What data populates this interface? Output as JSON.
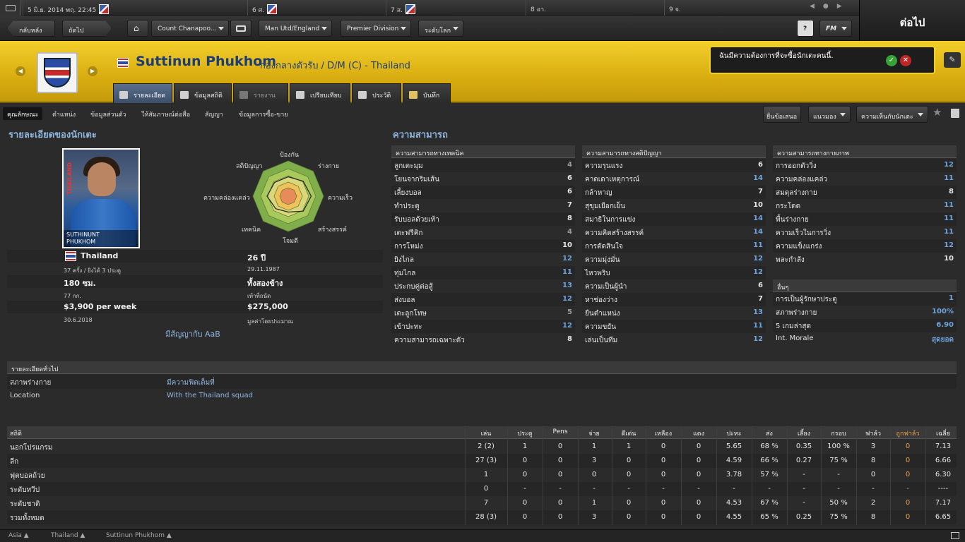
{
  "calendar": {
    "today": "5 มิ.ย. 2014 พฤ. 22:45",
    "days": [
      "6 ศ.",
      "7 ส.",
      "8 อา.",
      "9 จ."
    ]
  },
  "continue_label": "ต่อไป",
  "nav": {
    "back": "กลับหลัง",
    "forward": "ถัดไป",
    "manager": "Count Chanapoo...",
    "team": "Man Utd/England",
    "league": "Premier Division",
    "level": "ระดับโลก",
    "help": "?",
    "fm": "FM"
  },
  "player": {
    "name": "Suttinun Phukhom",
    "position": "กองกลางตัวรับ / D/M (C) - Thailand",
    "photo_caption_1": "SUTHINUNT",
    "photo_caption_2": "PHUKHOM",
    "photo_side": "THAILAND"
  },
  "tabs": [
    "รายละเอียด",
    "ข้อมูลสถิติ",
    "รายงาน",
    "เปรียบเทียบ",
    "ประวัติ",
    "บันทึก"
  ],
  "notification": {
    "text": "ฉันมีความต้องการที่จะซื้อนักเตะคนนี้."
  },
  "subnav": [
    "คุณลักษณะ",
    "ตำแหน่ง",
    "ข้อมูลส่วนตัว",
    "ให้สัมภาษณ์ต่อสื่อ",
    "สัญญา",
    "ข้อมูลการซื้อ-ขาย"
  ],
  "actions": {
    "offer": "ยื่นข้อเสนอ",
    "view": "แนวมอง",
    "opinion": "ความเห็นกับนักเตะ"
  },
  "details": {
    "title": "รายละเอียดของนักเตะ",
    "nation": "Thailand",
    "caps": "37 ครั้ง / ยิงได้ 3 ประตู",
    "age": "26 ปี",
    "dob": "29.11.1987",
    "height": "180 ซม.",
    "weight": "77 กก.",
    "foot": "ทั้งสองข้าง",
    "foot_label": "เท้าที่ถนัด",
    "wage": "$3,900 per week",
    "contract_end": "30.6.2018",
    "value": "$275,000",
    "value_label": "มูลค่าโดยประมาณ",
    "contract_with": "มีสัญญากับ AaB"
  },
  "radar": {
    "labels": [
      "ป้องกัน",
      "ร่างกาย",
      "ความเร็ว",
      "สร้างสรรค์",
      "โจมตี",
      "เทคนิค",
      "ความคล่องแคล่ว",
      "สติปัญญา"
    ],
    "values": [
      0.55,
      0.6,
      0.65,
      0.6,
      0.45,
      0.5,
      0.6,
      0.55
    ]
  },
  "abilities_title": "ความสามารถ",
  "technical": {
    "title": "ความสามารถทางเทคนิค",
    "items": [
      [
        "ลูกเตะมุม",
        "4"
      ],
      [
        "โยนจากริมเส้น",
        "6"
      ],
      [
        "เลี้ยงบอล",
        "6"
      ],
      [
        "ทำประตู",
        "7"
      ],
      [
        "รับบอลด้วยเท้า",
        "8"
      ],
      [
        "เตะฟรีคิก",
        "4"
      ],
      [
        "การโหม่ง",
        "10"
      ],
      [
        "ยิงไกล",
        "12"
      ],
      [
        "ทุ่มไกล",
        "11"
      ],
      [
        "ประกบคู่ต่อสู้",
        "13"
      ],
      [
        "ส่งบอล",
        "12"
      ],
      [
        "เตะลูกโทษ",
        "5"
      ],
      [
        "เข้าปะทะ",
        "12"
      ],
      [
        "ความสามารถเฉพาะตัว",
        "8"
      ]
    ]
  },
  "mental": {
    "title": "ความสามารถทางสติปัญญา",
    "items": [
      [
        "ความรุนแรง",
        "6"
      ],
      [
        "คาดเดาเหตุการณ์",
        "14"
      ],
      [
        "กล้าหาญ",
        "7"
      ],
      [
        "สุขุมเยือกเย็น",
        "10"
      ],
      [
        "สมาธิในการแข่ง",
        "14"
      ],
      [
        "ความคิดสร้างสรรค์",
        "14"
      ],
      [
        "การตัดสินใจ",
        "11"
      ],
      [
        "ความมุ่งมั่น",
        "12"
      ],
      [
        "ไหวพริบ",
        "12"
      ],
      [
        "ความเป็นผู้นำ",
        "6"
      ],
      [
        "หาช่องว่าง",
        "7"
      ],
      [
        "ยืนตำแหน่ง",
        "13"
      ],
      [
        "ความขยัน",
        "11"
      ],
      [
        "เล่นเป็นทีม",
        "12"
      ]
    ]
  },
  "physical": {
    "title": "ความสามารถทางกายภาพ",
    "items": [
      [
        "การออกตัววิ่ง",
        "12"
      ],
      [
        "ความคล่องแคล่ว",
        "11"
      ],
      [
        "สมดุลร่างกาย",
        "8"
      ],
      [
        "กระโดด",
        "11"
      ],
      [
        "พื้นร่างกาย",
        "11"
      ],
      [
        "ความเร็วในการวิ่ง",
        "11"
      ],
      [
        "ความแข็งแกร่ง",
        "12"
      ],
      [
        "พละกำลัง",
        "10"
      ]
    ]
  },
  "other": {
    "title": "อื่นๆ",
    "items": [
      [
        "การเป็นผู้รักษาประตู",
        "1"
      ],
      [
        "สภาพร่างกาย",
        "100%"
      ],
      [
        "5 เกมล่าสุด",
        "6.90"
      ],
      [
        "Int. Morale",
        "สุดยอด"
      ]
    ]
  },
  "general": {
    "title": "รายละเอียดทั่วไป",
    "rows": [
      [
        "สภาพร่างกาย",
        "มีความฟิตเต็มที่"
      ],
      [
        "Location",
        "With the Thailand squad"
      ]
    ]
  },
  "stats": {
    "headers": [
      "สถิติ",
      "เล่น",
      "ประตู",
      "Pens",
      "จ่าย",
      "ดีเด่น",
      "เหลือง",
      "แดง",
      "ปะทะ",
      "ส่ง",
      "เลี้ยง",
      "กรอบ",
      "ฟาล์ว",
      "ถูกฟาล์ว",
      "เฉลี่ย"
    ],
    "rows": [
      [
        "นอกโปรแกรม",
        "2 (2)",
        "1",
        "0",
        "1",
        "1",
        "0",
        "0",
        "5.65",
        "68 %",
        "0.35",
        "100 %",
        "3",
        "0",
        "7.13"
      ],
      [
        "ลีก",
        "27 (3)",
        "0",
        "0",
        "3",
        "0",
        "0",
        "0",
        "4.59",
        "66 %",
        "0.27",
        "75 %",
        "8",
        "0",
        "6.66"
      ],
      [
        "ฟุตบอลถ้วย",
        "1",
        "0",
        "0",
        "0",
        "0",
        "0",
        "0",
        "3.78",
        "57 %",
        "-",
        "-",
        "0",
        "0",
        "6.30"
      ],
      [
        "ระดับทวีป",
        "0",
        "-",
        "-",
        "-",
        "-",
        "-",
        "-",
        "-",
        "-",
        "-",
        "-",
        "-",
        "-",
        "----"
      ],
      [
        "ระดับชาติ",
        "7",
        "0",
        "0",
        "1",
        "0",
        "0",
        "0",
        "4.53",
        "67 %",
        "-",
        "50 %",
        "2",
        "0",
        "7.17"
      ],
      [
        "รวมทั้งหมด",
        "28 (3)",
        "0",
        "0",
        "3",
        "0",
        "0",
        "0",
        "4.55",
        "65 %",
        "0.25",
        "75 %",
        "8",
        "0",
        "6.65"
      ]
    ]
  },
  "breadcrumb": [
    "Asia",
    "Thailand",
    "Suttinun Phukhom"
  ],
  "colors": {
    "accent": "#8fb5e0",
    "value_blue": "#6ea3dc",
    "fouled_orange": "#e6a14a",
    "header_yellow": "#e6bd18"
  }
}
